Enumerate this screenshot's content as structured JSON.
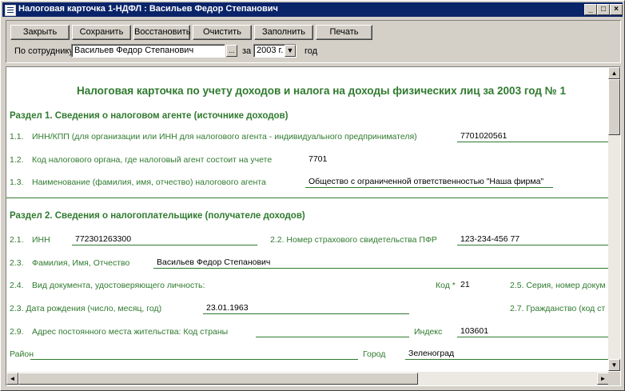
{
  "window": {
    "title": "Налоговая карточка 1-НДФЛ : Васильев Федор Степанович",
    "minimize": "_",
    "maximize": "□",
    "close": "×"
  },
  "toolbar": {
    "close_label": "Закрыть",
    "save_label": "Сохранить",
    "restore_label": "Восстановить",
    "clear_label": "Очистить",
    "fill_label": "Заполнить",
    "print_label": "Печать",
    "employee_label": "По сотруднику",
    "employee_value": "Васильев Федор Степанович",
    "ellipsis": "...",
    "for_label": "за",
    "year_value": "2003 г.",
    "year_suffix": "год"
  },
  "document": {
    "title": "Налоговая карточка по учету доходов и налога на доходы физических лиц за 2003 год № 1",
    "section1": {
      "header": "Раздел 1. Сведения о налоговом агенте (источнике доходов)",
      "r1_num": "1.1.",
      "r1_label": "ИНН/КПП (для организации или ИНН для налогового агента - индивидуального предпринимателя)",
      "r1_value": "7701020561",
      "r2_num": "1.2.",
      "r2_label": "Код налогового органа, где налоговый агент состоит на учете",
      "r2_value": "7701",
      "r3_num": "1.3.",
      "r3_label": "Наименование (фамилия, имя, отчество) налогового агента",
      "r3_value": "Общество с ограниченной ответственностью \"Наша фирма\""
    },
    "section2": {
      "header": "Раздел 2. Сведения о налогоплательщике (получателе доходов)",
      "r1_num": "2.1.",
      "r1_label": "ИНН",
      "r1_value": "772301263300",
      "r2_label": "2.2. Номер страхового свидетельства ПФР",
      "r2_value": "123-234-456 77",
      "r3_num": "2.3.",
      "r3_label": "Фамилия, Имя, Отчество",
      "r3_value": "Васильев Федор Степанович",
      "r4_num": "2.4.",
      "r4_label": "Вид документа, удостоверяющего личность:",
      "r4_code_label": "Код *",
      "r4_code_value": "21",
      "r5_label": "2.5. Серия, номер докум",
      "r6_label": "2.3. Дата рождения (число, месяц, год)",
      "r6_value": "23.01.1963",
      "r7_label": "2.7. Гражданство (код ст",
      "r8_num": "2.9.",
      "r8_label": "Адрес постоянного места жительства: Код страны",
      "r8_index_label": "Индекс",
      "r8_index_value": "103601",
      "district_label": "Район",
      "city_label": "Город",
      "city_value": "Зеленоград"
    }
  },
  "scroll": {
    "up": "▲",
    "down": "▼",
    "left": "◄",
    "right": "►"
  }
}
